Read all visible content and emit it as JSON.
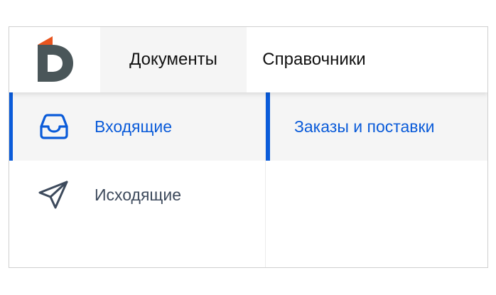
{
  "header": {
    "logo_icon": "d-logo-icon",
    "tabs": [
      {
        "label": "Документы",
        "active": true
      },
      {
        "label": "Справочники",
        "active": false
      }
    ]
  },
  "sidebar": {
    "items": [
      {
        "label": "Входящие",
        "icon": "inbox-tray-icon",
        "active": true
      },
      {
        "label": "Исходящие",
        "icon": "send-plane-icon",
        "active": false
      }
    ]
  },
  "submenu": {
    "items": [
      {
        "label": "Заказы и поставки",
        "active": true
      }
    ]
  },
  "colors": {
    "accent": "#0a5bd9",
    "logo_dark": "#4a5659",
    "logo_orange": "#e8541e",
    "active_bg": "#f5f5f5"
  }
}
